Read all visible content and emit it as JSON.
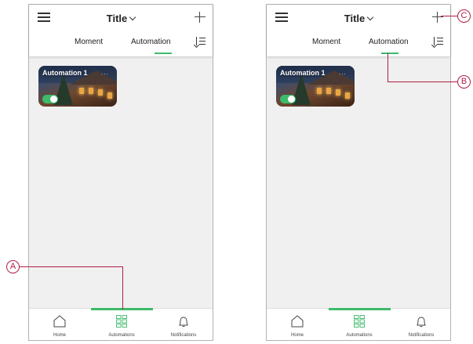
{
  "header": {
    "title": "Title"
  },
  "tabs": [
    {
      "label": "Moment"
    },
    {
      "label": "Automation"
    }
  ],
  "card": {
    "title": "Automation 1",
    "menu": "..."
  },
  "nav": [
    {
      "label": "Home"
    },
    {
      "label": "Automations"
    },
    {
      "label": "Notifications"
    }
  ],
  "callouts": {
    "a": "A",
    "b": "B",
    "c": "C"
  },
  "colors": {
    "accent": "#3dba6a",
    "callout": "#b01e45",
    "screen_bg": "#f0f0f0"
  },
  "icons": [
    "menu-icon",
    "chevron-down-icon",
    "plus-icon",
    "sort-icon",
    "home-icon",
    "grid-icon",
    "bell-icon"
  ],
  "toggle": {
    "enabled": true
  }
}
